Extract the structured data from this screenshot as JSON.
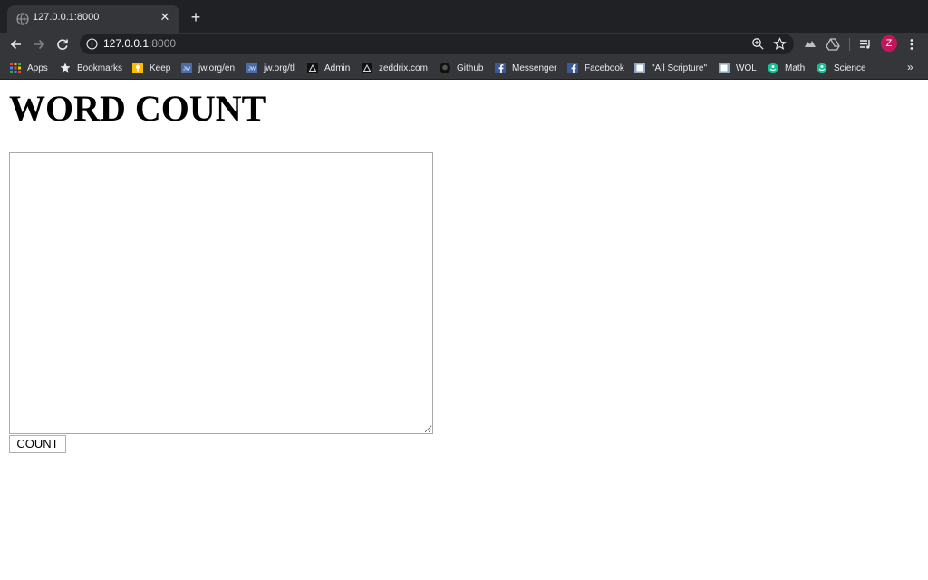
{
  "browser": {
    "tab": {
      "title": "127.0.0.1:8000"
    },
    "address": {
      "host": "127.0.0.1",
      "port": ":8000"
    },
    "profile_initial": "Z",
    "bookmarks": [
      {
        "label": "Apps",
        "icon": "apps-grid-icon"
      },
      {
        "label": "Bookmarks",
        "icon": "star-icon"
      },
      {
        "label": "Keep",
        "icon": "keep-icon"
      },
      {
        "label": "jw.org/en",
        "icon": "jw-icon"
      },
      {
        "label": "jw.org/tl",
        "icon": "jw-icon"
      },
      {
        "label": "Admin",
        "icon": "admin-icon"
      },
      {
        "label": "zeddrix.com",
        "icon": "zeddrix-icon"
      },
      {
        "label": "Github",
        "icon": "github-icon"
      },
      {
        "label": "Messenger",
        "icon": "facebook-icon"
      },
      {
        "label": "Facebook",
        "icon": "facebook-icon"
      },
      {
        "label": "\"All Scripture\"",
        "icon": "wol-icon"
      },
      {
        "label": "WOL",
        "icon": "wol-icon"
      },
      {
        "label": "Math",
        "icon": "khan-icon"
      },
      {
        "label": "Science",
        "icon": "khan-icon"
      }
    ],
    "more_bookmarks": "»"
  },
  "page": {
    "title": "WORD COUNT",
    "textarea": {
      "value": "",
      "placeholder": ""
    },
    "count_button": "COUNT"
  },
  "colors": {
    "chrome_dark": "#202124",
    "chrome_toolbar": "#35363a",
    "avatar": "#c2185b"
  }
}
